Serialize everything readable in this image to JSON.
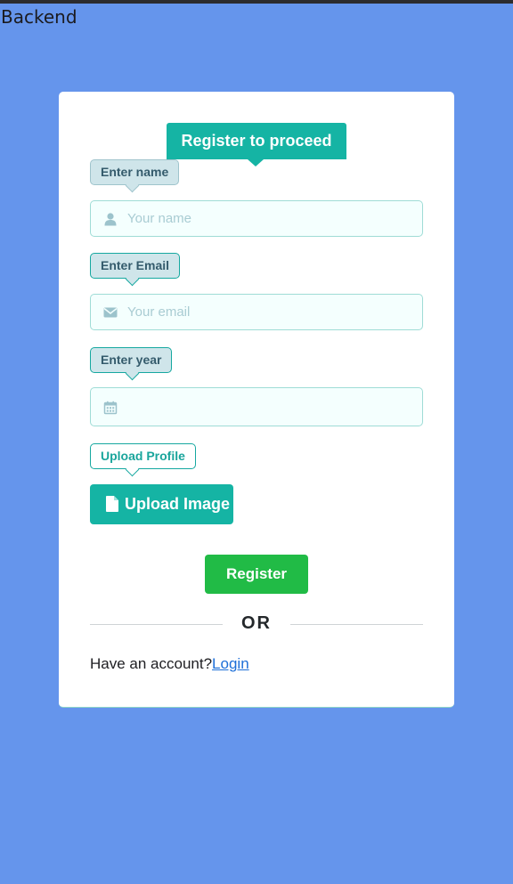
{
  "app": {
    "title": "Backend"
  },
  "form": {
    "heading": "Register to proceed",
    "name": {
      "label": "Enter name",
      "placeholder": "Your name",
      "icon": "user-icon"
    },
    "email": {
      "label": "Enter Email",
      "placeholder": "Your email",
      "icon": "envelope-icon"
    },
    "year": {
      "label": "Enter year",
      "icon": "calendar-icon"
    },
    "upload": {
      "label": "Upload Profile",
      "button_label": "Upload Image",
      "icon": "file-icon"
    },
    "register_label": "Register",
    "divider_text": "OR",
    "footer": {
      "prompt": "Have an account?",
      "link_text": "Login"
    }
  },
  "colors": {
    "background": "#6595ec",
    "accent": "#15b4a4",
    "register": "#21bb46",
    "link": "#1d6fd8"
  }
}
